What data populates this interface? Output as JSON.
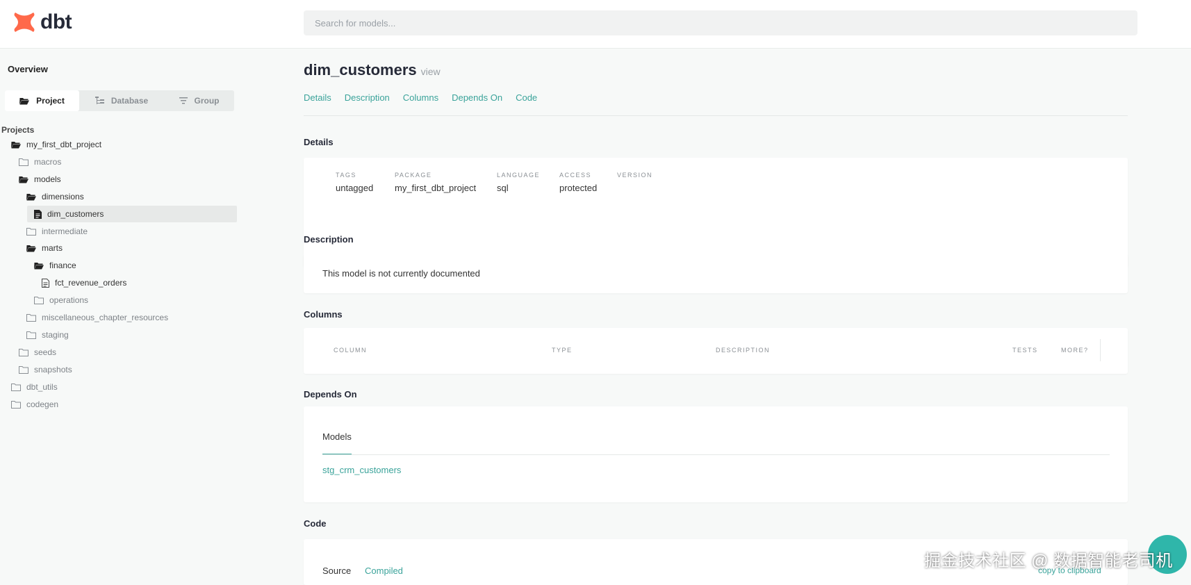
{
  "header": {
    "logo_text": "dbt",
    "search_placeholder": "Search for models..."
  },
  "sidebar": {
    "overview_label": "Overview",
    "segments": [
      {
        "label": "Project",
        "icon": "folder-open-icon",
        "active": true
      },
      {
        "label": "Database",
        "icon": "database-tree-icon",
        "active": false
      },
      {
        "label": "Group",
        "icon": "filter-icon",
        "active": false
      }
    ],
    "projects_label": "Projects",
    "tree": [
      {
        "label": "my_first_dbt_project",
        "icon": "folder-open-icon",
        "depth": 1,
        "muted": false
      },
      {
        "label": "macros",
        "icon": "folder-icon",
        "depth": 2,
        "muted": true
      },
      {
        "label": "models",
        "icon": "folder-open-icon",
        "depth": 2,
        "muted": false
      },
      {
        "label": "dimensions",
        "icon": "folder-open-icon",
        "depth": 3,
        "muted": false
      },
      {
        "label": "dim_customers",
        "icon": "file-icon",
        "depth": 4,
        "muted": false,
        "selected": true
      },
      {
        "label": "intermediate",
        "icon": "folder-icon",
        "depth": 3,
        "muted": true
      },
      {
        "label": "marts",
        "icon": "folder-open-icon",
        "depth": 3,
        "muted": false
      },
      {
        "label": "finance",
        "icon": "folder-open-icon",
        "depth": 4,
        "muted": false
      },
      {
        "label": "fct_revenue_orders",
        "icon": "file-icon",
        "depth": 5,
        "muted": false
      },
      {
        "label": "operations",
        "icon": "folder-icon",
        "depth": 4,
        "muted": true
      },
      {
        "label": "miscellaneous_chapter_resources",
        "icon": "folder-icon",
        "depth": 3,
        "muted": true
      },
      {
        "label": "staging",
        "icon": "folder-icon",
        "depth": 3,
        "muted": true
      },
      {
        "label": "seeds",
        "icon": "folder-icon",
        "depth": 2,
        "muted": true
      },
      {
        "label": "snapshots",
        "icon": "folder-icon",
        "depth": 2,
        "muted": true
      },
      {
        "label": "dbt_utils",
        "icon": "folder-icon",
        "depth": 1,
        "muted": true
      },
      {
        "label": "codegen",
        "icon": "folder-icon",
        "depth": 1,
        "muted": true
      }
    ]
  },
  "main": {
    "title": "dim_customers",
    "title_type": "view",
    "nav": [
      "Details",
      "Description",
      "Columns",
      "Depends On",
      "Code"
    ],
    "details": {
      "section_title": "Details",
      "fields": [
        {
          "key": "TAGS",
          "value": "untagged"
        },
        {
          "key": "PACKAGE",
          "value": "my_first_dbt_project"
        },
        {
          "key": "LANGUAGE",
          "value": "sql"
        },
        {
          "key": "ACCESS",
          "value": "protected"
        },
        {
          "key": "VERSION",
          "value": ""
        }
      ]
    },
    "description": {
      "section_title": "Description",
      "text": "This model is not currently documented"
    },
    "columns": {
      "section_title": "Columns",
      "headers": [
        "COLUMN",
        "TYPE",
        "DESCRIPTION",
        "TESTS",
        "MORE?"
      ]
    },
    "depends_on": {
      "section_title": "Depends On",
      "tab_label": "Models",
      "items": [
        "stg_crm_customers"
      ]
    },
    "code": {
      "section_title": "Code",
      "tabs": [
        "Source",
        "Compiled"
      ],
      "copy_label": "copy to clipboard"
    }
  },
  "overlay": {
    "watermark": "掘金技术社区 @ 数据智能老司机"
  },
  "colors": {
    "accent": "#3aa39a",
    "logo": "#ff694a",
    "fab": "#2fb6aa"
  }
}
